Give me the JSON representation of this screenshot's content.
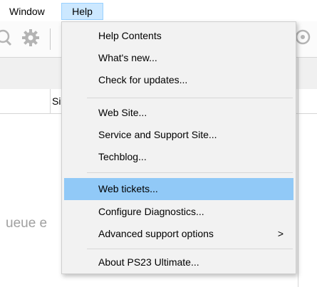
{
  "menubar": {
    "items": [
      {
        "label": "Window"
      },
      {
        "label": "Help"
      }
    ]
  },
  "background": {
    "column_header_fragment": "Si",
    "queue_text_fragment": "ueue e"
  },
  "icons": {
    "toolbar": [
      "magnifier-icon",
      "gear-icon",
      "cloud-icon"
    ],
    "submenu_arrow": "chevron-right-icon"
  },
  "colors": {
    "menu_background": "#f2f2f2",
    "highlight": "#91c9f7",
    "menubar_active": "#cce8ff"
  },
  "help_menu": {
    "groups": [
      {
        "items": [
          {
            "label": "Help Contents"
          },
          {
            "label": "What's new..."
          },
          {
            "label": "Check for updates..."
          }
        ]
      },
      {
        "items": [
          {
            "label": "Web Site..."
          },
          {
            "label": "Service and Support Site..."
          },
          {
            "label": "Techblog..."
          }
        ]
      },
      {
        "items": [
          {
            "label": "Web tickets...",
            "highlighted": true
          },
          {
            "label": "Configure Diagnostics..."
          },
          {
            "label": "Advanced support options",
            "submenu_arrow": ">"
          }
        ]
      },
      {
        "items": [
          {
            "label": "About PS23 Ultimate..."
          }
        ]
      }
    ]
  }
}
